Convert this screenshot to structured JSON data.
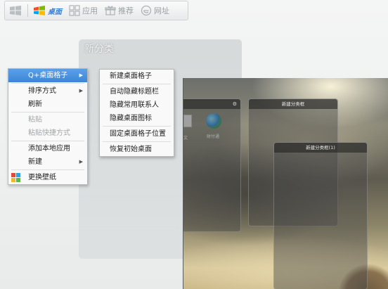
{
  "toolbar": {
    "desktop_label": "桌面",
    "apps_label": "应用",
    "recommend_label": "推荐",
    "web_label": "网址"
  },
  "category_panel": {
    "title": "新分类"
  },
  "context_menu": {
    "items": [
      {
        "label": "Q+桌面格子"
      },
      {
        "label": "排序方式"
      },
      {
        "label": "刷新"
      },
      {
        "label": "粘贴"
      },
      {
        "label": "粘贴快捷方式"
      },
      {
        "label": "添加本地应用"
      },
      {
        "label": "新建"
      },
      {
        "label": "更换壁纸"
      }
    ]
  },
  "submenu": {
    "items": [
      {
        "label": "新建桌面格子"
      },
      {
        "label": "自动隐藏标题栏"
      },
      {
        "label": "隐藏常用联系人"
      },
      {
        "label": "隐藏桌面图标"
      },
      {
        "label": "固定桌面格子位置"
      },
      {
        "label": "恢复初始桌面"
      }
    ]
  },
  "preview": {
    "window1_title": "新建分类框",
    "window2_title": "新建分类框(1)",
    "icon_label": "财付通",
    "doc_label": "文"
  },
  "colors": {
    "highlight": "#3d86d8",
    "menu_bg": "#f9f9f9"
  }
}
